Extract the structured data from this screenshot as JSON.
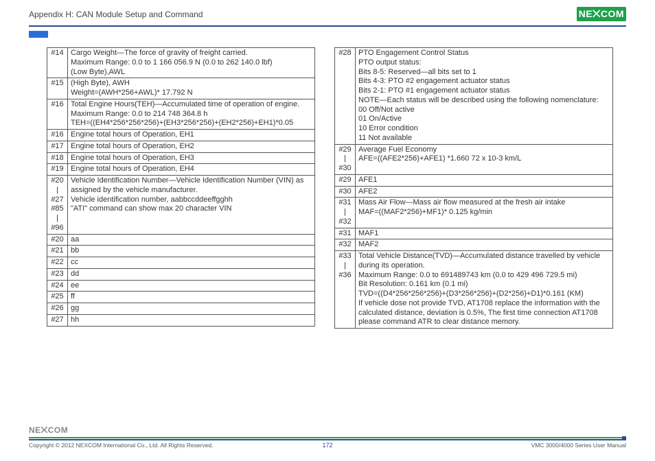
{
  "header": {
    "title": "Appendix H: CAN Module Setup and Command",
    "logo": "NE⨉COM"
  },
  "left_rows": [
    {
      "idx": "#14",
      "desc": "Cargo Weight—The force of gravity of freight carried.\nMaximum Range: 0.0 to 1 166 056.9 N (0.0 to 262 140.0 lbf)\n(Low Byte),AWL"
    },
    {
      "idx": "#15",
      "desc": "(High Byte), AWH\nWeight=(AWH*256+AWL)* 17.792 N"
    },
    {
      "idx": "#16",
      "desc": "Total Engine Hours(TEH)—Accumulated time of operation of engine.\nMaximum Range: 0.0 to 214 748 364.8 h\nTEH=((EH4*256*256*256)+(EH3*256*256)+(EH2*256)+EH1)*0.05"
    },
    {
      "idx": "#16",
      "desc": "Engine total hours of Operation, EH1"
    },
    {
      "idx": "#17",
      "desc": "Engine total hours of Operation, EH2"
    },
    {
      "idx": "#18",
      "desc": "Engine total hours of Operation, EH3"
    },
    {
      "idx": "#19",
      "desc": "Engine total hours of Operation, EH4"
    },
    {
      "idx": "#20\n|\n#27\n#85\n|\n#96",
      "desc": "Vehicle Identification Number—Vehicle Identification Number (VIN) as assigned by the vehicle manufacturer.\nVehicle identification number, aabbccddeeffgghh\n\"ATI\" command can show max 20 character VIN"
    },
    {
      "idx": "#20",
      "desc": "aa"
    },
    {
      "idx": "#21",
      "desc": "bb"
    },
    {
      "idx": "#22",
      "desc": "cc"
    },
    {
      "idx": "#23",
      "desc": "dd"
    },
    {
      "idx": "#24",
      "desc": "ee"
    },
    {
      "idx": "#25",
      "desc": "ff"
    },
    {
      "idx": "#26",
      "desc": "gg"
    },
    {
      "idx": "#27",
      "desc": "hh"
    }
  ],
  "right_rows": [
    {
      "idx": "#28",
      "desc": "PTO Engagement Control Status\nPTO output status:\nBits 8-5: Reserved—all bits set to 1\nBits 4-3: PTO #2 engagement actuator status\nBits 2-1: PTO #1 engagement actuator status\nNOTE—Each status will be described using the following nomenclature:\n00 Off/Not active\n01 On/Active\n10 Error condition\n11 Not available"
    },
    {
      "idx": "#29\n|\n#30",
      "desc": "Average Fuel Economy\nAFE=((AFE2*256)+AFE1) *1.660 72 x 10-3 km/L"
    },
    {
      "idx": "#29",
      "desc": "AFE1"
    },
    {
      "idx": "#30",
      "desc": "AFE2"
    },
    {
      "idx": "#31\n|\n#32",
      "desc": "Mass Air Flow—Mass air flow measured at the fresh air intake\nMAF=((MAF2*256)+MF1)* 0.125 kg/min"
    },
    {
      "idx": "#31",
      "desc": "MAF1"
    },
    {
      "idx": "#32",
      "desc": "MAF2"
    },
    {
      "idx": "#33\n|\n#36",
      "desc": "Total Vehicle Distance(TVD)—Accumulated distance travelled by vehicle during its operation.\nMaximum Range: 0.0 to 691489743 km (0.0 to 429 496 729.5 mi)\nBit Resolution: 0.161 km (0.1 mi)\nTVD=((D4*256*256*256)+(D3*256*256)+(D2*256)+D1)*0.161 (KM)\nIf vehicle dose not provide TVD, AT1708 replace the information with the calculated distance, deviation is 0.5%, The first time connection AT1708 please command ATR to clear distance memory."
    }
  ],
  "footer": {
    "logo": "NE⨉COM",
    "copyright": "Copyright © 2012 NEXCOM International Co., Ltd. All Rights Reserved.",
    "page": "172",
    "manual": "VMC 3000/4000 Series User Manual"
  }
}
